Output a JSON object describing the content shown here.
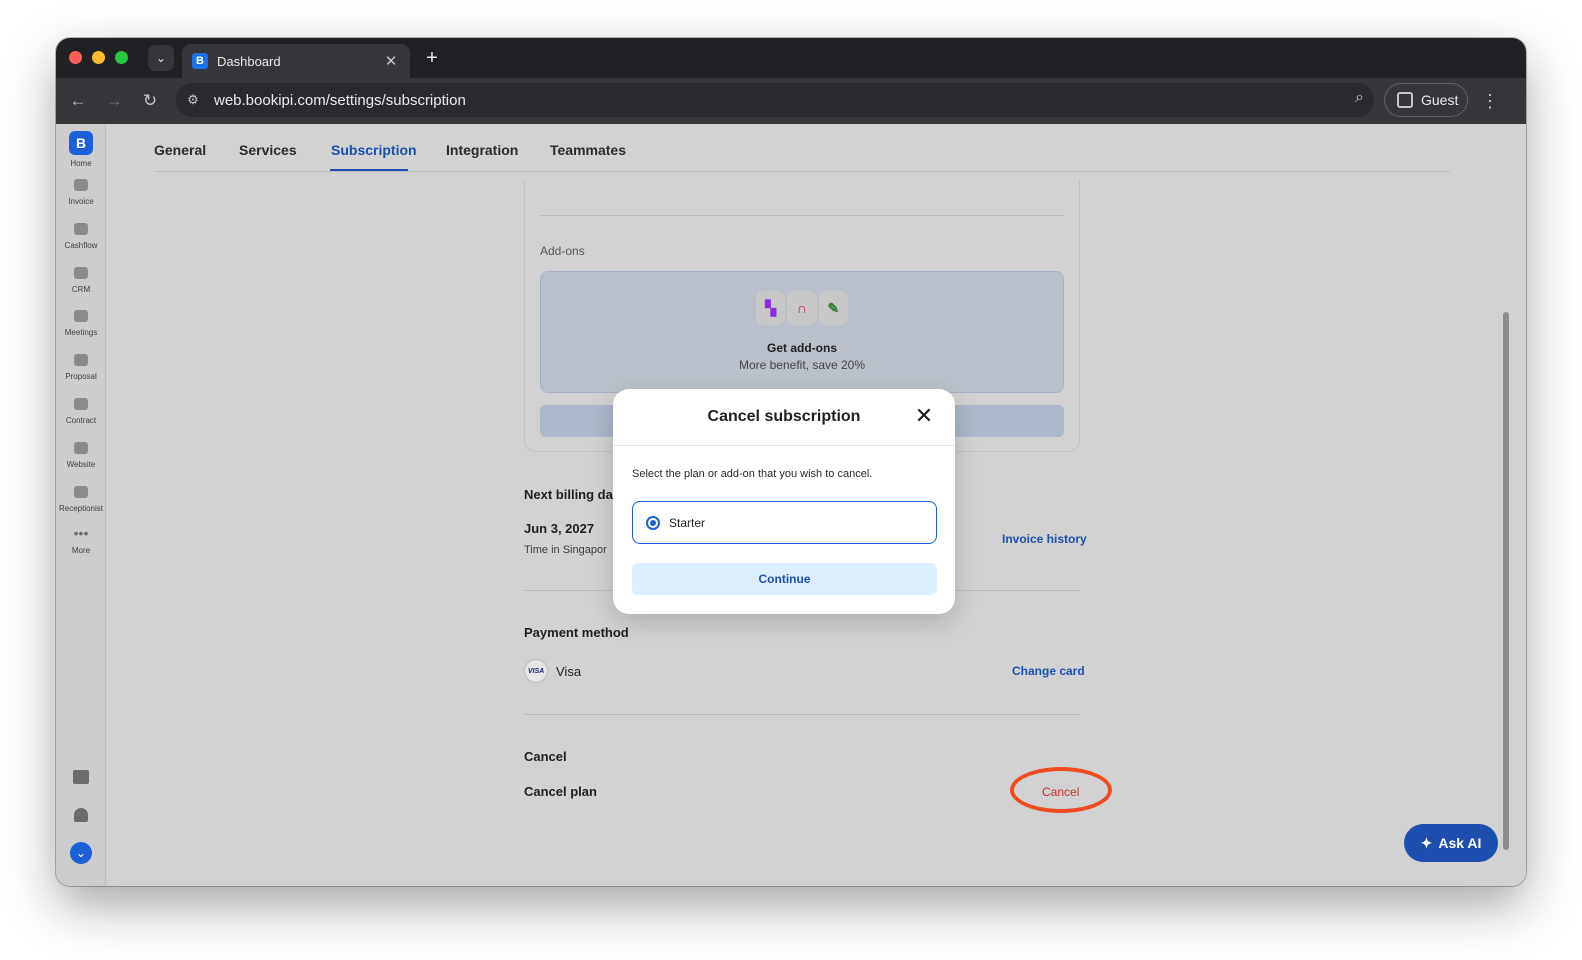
{
  "browser": {
    "tab_title": "Dashboard",
    "url": "web.bookipi.com/settings/subscription",
    "profile_label": "Guest"
  },
  "sidebar": {
    "items": [
      {
        "label": "Home",
        "icon": "home-logo-icon"
      },
      {
        "label": "Invoice",
        "icon": "invoice-icon"
      },
      {
        "label": "Cashflow",
        "icon": "cashflow-icon"
      },
      {
        "label": "CRM",
        "icon": "crm-icon"
      },
      {
        "label": "Meetings",
        "icon": "meetings-icon"
      },
      {
        "label": "Proposal",
        "icon": "proposal-icon"
      },
      {
        "label": "Contract",
        "icon": "contract-icon"
      },
      {
        "label": "Website",
        "icon": "website-icon"
      },
      {
        "label": "Receptionist",
        "icon": "receptionist-icon"
      },
      {
        "label": "More",
        "icon": "more-icon"
      }
    ]
  },
  "settings_tabs": [
    "General",
    "Services",
    "Subscription",
    "Integration",
    "Teammates"
  ],
  "active_tab": "Subscription",
  "addons": {
    "label": "Add-ons",
    "title": "Get add-ons",
    "subtitle": "More benefit, save 20%"
  },
  "billing": {
    "title": "Next billing dat",
    "date": "Jun 3, 2027",
    "timezone": "Time in Singapor",
    "invoice_history": "Invoice history"
  },
  "payment": {
    "title": "Payment method",
    "card": "Visa",
    "change_card": "Change card"
  },
  "cancel_section": {
    "title": "Cancel",
    "row_label": "Cancel plan",
    "action": "Cancel"
  },
  "ask_ai": "Ask AI",
  "modal": {
    "title": "Cancel subscription",
    "description": "Select the plan or add-on that you wish to cancel.",
    "option": "Starter",
    "continue": "Continue"
  },
  "colors": {
    "brand": "#1d5fd6",
    "link": "#1d4fae",
    "danger": "#c0302a",
    "highlight": "#f04b20"
  }
}
